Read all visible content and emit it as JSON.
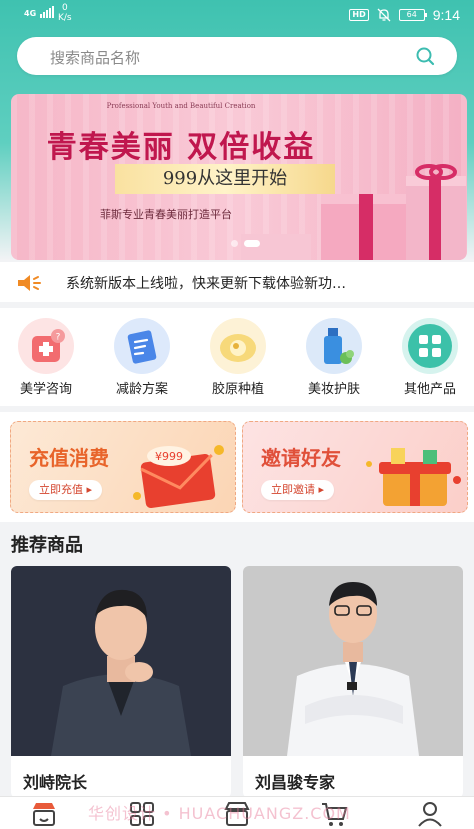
{
  "status_bar": {
    "network": "4G",
    "speed_value": "0",
    "speed_unit": "K/s",
    "hd": "HD",
    "battery": "64",
    "time": "9:14"
  },
  "search": {
    "placeholder": "搜索商品名称",
    "icon": "search-icon"
  },
  "banner": {
    "english": "Professional Youth and Beautiful Creation",
    "title": "青春美丽 双倍收益",
    "price_line": "999从这里开始",
    "subtitle": "菲斯专业青春美丽打造平台"
  },
  "notice": {
    "icon": "speaker-icon",
    "text": "系统新版本上线啦，快来更新下载体验新功…"
  },
  "categories": [
    {
      "label": "美学咨询",
      "icon": "doctor-icon",
      "color": "#f3777a"
    },
    {
      "label": "减龄方案",
      "icon": "clipboard-icon",
      "color": "#4a86e8"
    },
    {
      "label": "胶原种植",
      "icon": "collagen-icon",
      "color": "#f2c863"
    },
    {
      "label": "美妆护肤",
      "icon": "skincare-bottle-icon",
      "color": "#3a8fe0"
    },
    {
      "label": "其他产品",
      "icon": "grid-icon",
      "color": "#3cc1a9"
    }
  ],
  "promos": [
    {
      "title": "充值消费",
      "button": "立即充值",
      "badge": "¥999",
      "title_color": "#e8642a"
    },
    {
      "title": "邀请好友",
      "button": "立即邀请",
      "title_color": "#e0503a"
    }
  ],
  "recommend": {
    "title": "推荐商品",
    "items": [
      {
        "name": "刘峙院长"
      },
      {
        "name": "刘昌骏专家"
      }
    ]
  },
  "watermark": "华创设计 • HUACHUANGZ.COM",
  "tabbar": [
    {
      "icon": "home-shop-icon"
    },
    {
      "icon": "category-grid-icon"
    },
    {
      "icon": "store-icon"
    },
    {
      "icon": "cart-icon"
    },
    {
      "icon": "profile-icon"
    }
  ]
}
